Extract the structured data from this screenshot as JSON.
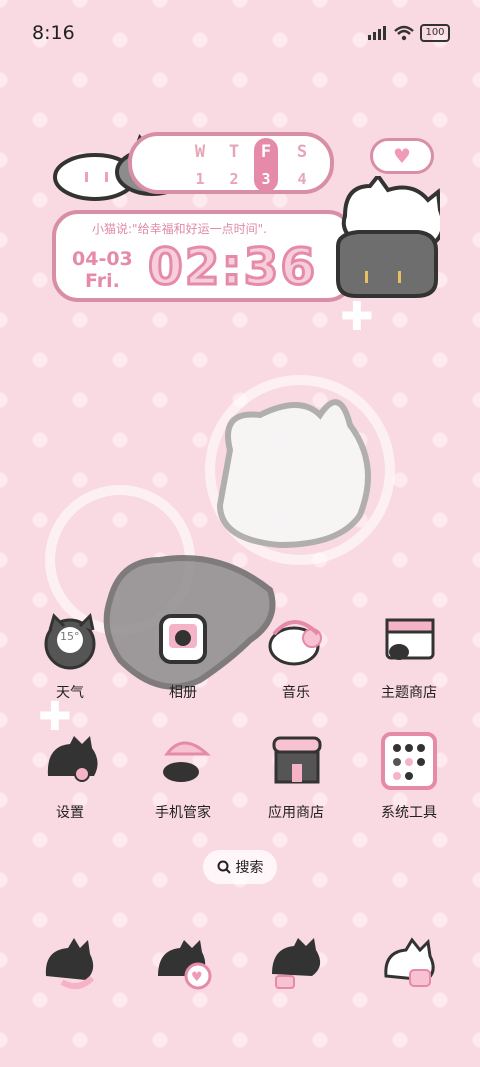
{
  "status": {
    "time": "8:16",
    "battery": "100"
  },
  "widget": {
    "days": [
      {
        "letter": "W",
        "num": "1"
      },
      {
        "letter": "T",
        "num": "2"
      },
      {
        "letter": "F",
        "num": "3"
      },
      {
        "letter": "S",
        "num": "4"
      }
    ],
    "quote": "小猫说:\"给幸福和好运一点时间\".",
    "date": "04-03",
    "weekday": "Fri.",
    "clock": "02:36"
  },
  "apps": [
    {
      "label": "天气",
      "icon": "weather-icon",
      "temp": "15°"
    },
    {
      "label": "相册",
      "icon": "gallery-icon"
    },
    {
      "label": "音乐",
      "icon": "music-icon"
    },
    {
      "label": "主题商店",
      "icon": "theme-store-icon"
    },
    {
      "label": "设置",
      "icon": "settings-icon"
    },
    {
      "label": "手机管家",
      "icon": "phone-manager-icon"
    },
    {
      "label": "应用商店",
      "icon": "app-store-icon"
    },
    {
      "label": "系统工具",
      "icon": "system-tools-icon"
    }
  ],
  "search": {
    "label": "搜索"
  },
  "dock": [
    {
      "icon": "phone-cat-icon"
    },
    {
      "icon": "messages-cat-icon"
    },
    {
      "icon": "browser-cat-icon"
    },
    {
      "icon": "camera-cat-icon"
    }
  ]
}
